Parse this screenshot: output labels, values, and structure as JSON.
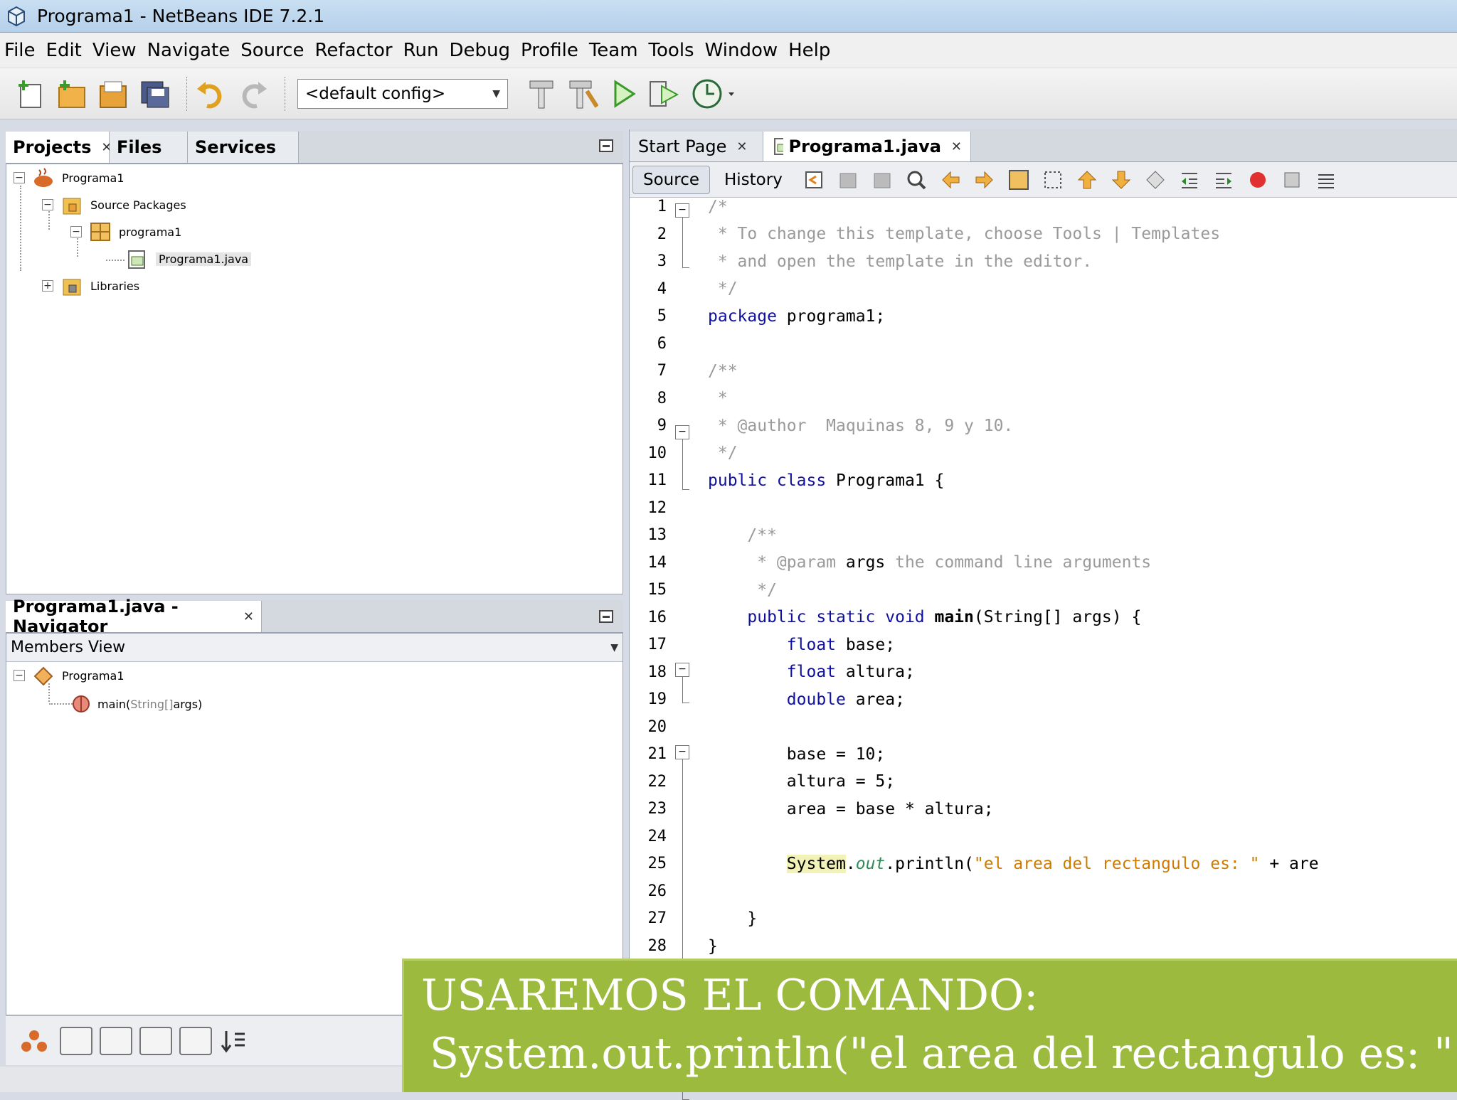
{
  "window": {
    "title": "Programa1 - NetBeans IDE 7.2.1"
  },
  "menu": [
    "File",
    "Edit",
    "View",
    "Navigate",
    "Source",
    "Refactor",
    "Run",
    "Debug",
    "Profile",
    "Team",
    "Tools",
    "Window",
    "Help"
  ],
  "toolbar": {
    "config_value": "<default config>"
  },
  "projects_panel": {
    "tabs": [
      "Projects",
      "Files",
      "Services"
    ],
    "tree": [
      "Programa1",
      "Source Packages",
      "programa1",
      "Programa1.java",
      "Libraries"
    ]
  },
  "navigator": {
    "title": "Programa1.java - Navigator",
    "view": "Members View",
    "tree": {
      "class": "Programa1",
      "method_name": "main(",
      "method_params": "String[]",
      "method_tail": " args)"
    }
  },
  "editor": {
    "tabs": [
      "Start Page",
      "Programa1.java"
    ],
    "source_label": "Source",
    "history_label": "History",
    "line_numbers": [
      "1",
      "2",
      "3",
      "4",
      "5",
      "6",
      "7",
      "8",
      "9",
      "10",
      "11",
      "12",
      "13",
      "14",
      "15",
      "16",
      "17",
      "18",
      "19",
      "20",
      "21",
      "22",
      "23",
      "24",
      "25",
      "26",
      "27",
      "28"
    ],
    "code": {
      "l1": "/*",
      "l2": " * To change this template, choose Tools | Templates",
      "l3": " * and open the template in the editor.",
      "l4": " */",
      "l5_kw": "package",
      "l5_rest": " programa1;",
      "l7": "/**",
      "l8": " *",
      "l9": " * @author  Maquinas 8, 9 y 10.",
      "l10": " */",
      "l11_kw": "public class",
      "l11_rest": " Programa1 {",
      "l13": "    /**",
      "l14_a": "     * @param ",
      "l14_b": "args",
      "l14_c": " the command line arguments",
      "l15": "     */",
      "l16_kw": "    public static void",
      "l16_main": " main",
      "l16_rest": "(String[] args) {",
      "l17_kw": "        float",
      "l17_rest": " base;",
      "l18_kw": "        float",
      "l18_rest": " altura;",
      "l19_kw": "        double",
      "l19_rest": " area;",
      "l21": "        base = 10;",
      "l22": "        altura = 5;",
      "l23": "        area = base * altura;",
      "l25_indent": "        ",
      "l25_sys": "System",
      "l25_dot": ".",
      "l25_out": "out",
      "l25_mid": ".println(",
      "l25_str": "\"el area del rectangulo es: \"",
      "l25_end": " + are",
      "l27": "    }",
      "l28": "}"
    }
  },
  "overlay": {
    "line1": "USAREMOS EL COMANDO:",
    "line2": "System.out.println(\"el area del rectangulo es: \" + a"
  }
}
